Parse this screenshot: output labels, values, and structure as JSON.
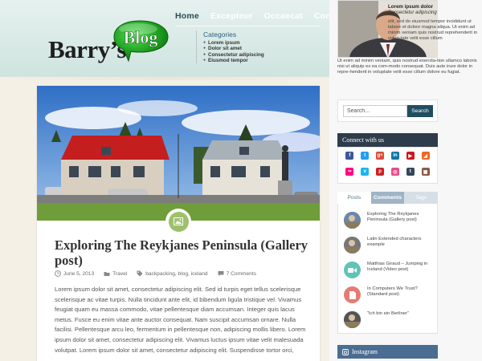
{
  "nav": {
    "items": [
      "Home",
      "Excepteur",
      "Occaecat",
      "Contact"
    ]
  },
  "logo": {
    "text": "Barry’s",
    "bubble_text": "Blog"
  },
  "categories": {
    "title": "Categories",
    "items": [
      "Lorem ipsum",
      "Dolor sit amet",
      "Consectetur adipiscing",
      "Eiusmod tempor"
    ]
  },
  "post": {
    "title": "Exploring The Reykjanes Peninsula (Gallery post)",
    "date": "June 5, 2013",
    "category": "Travel",
    "tags": "backpacking, blog, iceland",
    "comments": "7 Comments",
    "excerpt": "Lorem ipsum dolor sit amet, consectetur adipiscing elit. Sed id turpis eget tellus scelerisque scelerisque ac vitae turpis. Nulla tincidunt ante elit, id bibendum ligula tristique vel. Vivamus feugiat quam eu massa commodo, vitae pellentesque diam accumsan. Integer quis lacus metus. Fusce eu enim vitae ante auctor consequat. Nam suscipit accumsan ornare. Nulla facilisi. Pellentesque arcu leo, fermentum in pellentesque non, adipiscing mollis libero. Lorem ipsum dolor sit amet, consectetur adipiscing elit. Vivamus luctus ipsum vitae velit malesuada volutpat. Lorem ipsum dolor sit amet, consectetur adipiscing elit. Suspendisse tortor orci,"
  },
  "profile": {
    "name": "Lorem ipsum dolor",
    "subtitle": "Consectetur adipiscing",
    "text_right": "elit, sed do eiusmod tempor incididunt ut labore et dolore magna aliqua. Ut enim ad minim veniam quis nostrud reprehenderit in volup-tate velit esse cillum",
    "text_full": "Ut enim ad minim veniam, quis nostrud exercita-tion ullamco laboris nisi ut aliquip ex ea com-modo consequat. Duis aute irure dolor in repre-henderit in voluptate velit esse cillum dolore eu fugiat."
  },
  "search": {
    "placeholder": "Search...",
    "button": "Search"
  },
  "connect": {
    "title": "Connect with us"
  },
  "social": [
    {
      "icon": "facebook-icon",
      "glyph": "f",
      "color": "#3b5998"
    },
    {
      "icon": "twitter-icon",
      "glyph": "t",
      "color": "#1da1f2"
    },
    {
      "icon": "google-plus-icon",
      "glyph": "g+",
      "color": "#dd4b39"
    },
    {
      "icon": "linkedin-icon",
      "glyph": "in",
      "color": "#0e76a8"
    },
    {
      "icon": "youtube-icon",
      "glyph": "▶",
      "color": "#cc181e"
    },
    {
      "icon": "rss-icon",
      "glyph": "◢",
      "color": "#f26522"
    },
    {
      "icon": "flickr-icon",
      "glyph": "••",
      "color": "#ff0084"
    },
    {
      "icon": "vimeo-icon",
      "glyph": "v",
      "color": "#1ab7ea"
    },
    {
      "icon": "pinterest-icon",
      "glyph": "p",
      "color": "#cb2027"
    },
    {
      "icon": "dribbble-icon",
      "glyph": "◎",
      "color": "#ea4c89"
    },
    {
      "icon": "tumblr-icon",
      "glyph": "t",
      "color": "#35465c"
    },
    {
      "icon": "instagram-icon",
      "glyph": "▣",
      "color": "#8a5a44"
    }
  ],
  "tabs": [
    "Posts",
    "Comments",
    "Tags"
  ],
  "tab_posts": [
    {
      "title": "Exploring The Reykjanes Peninsula (Gallery post)",
      "thumb": "photo",
      "color": "#6b87a8"
    },
    {
      "title": "Latin Extended characters example",
      "thumb": "photo",
      "color": "#777"
    },
    {
      "title": "Matthias Giraud – Jumping in Iceland (Video post)",
      "thumb": "video",
      "color": "#5fc4b8"
    },
    {
      "title": "In Computers We Trust? (Standard post)",
      "thumb": "document",
      "color": "#e57b74"
    },
    {
      "title": "“Ich bin ein Berliner”",
      "thumb": "photo",
      "color": "#555"
    }
  ],
  "instagram": {
    "title": "Instagram"
  }
}
